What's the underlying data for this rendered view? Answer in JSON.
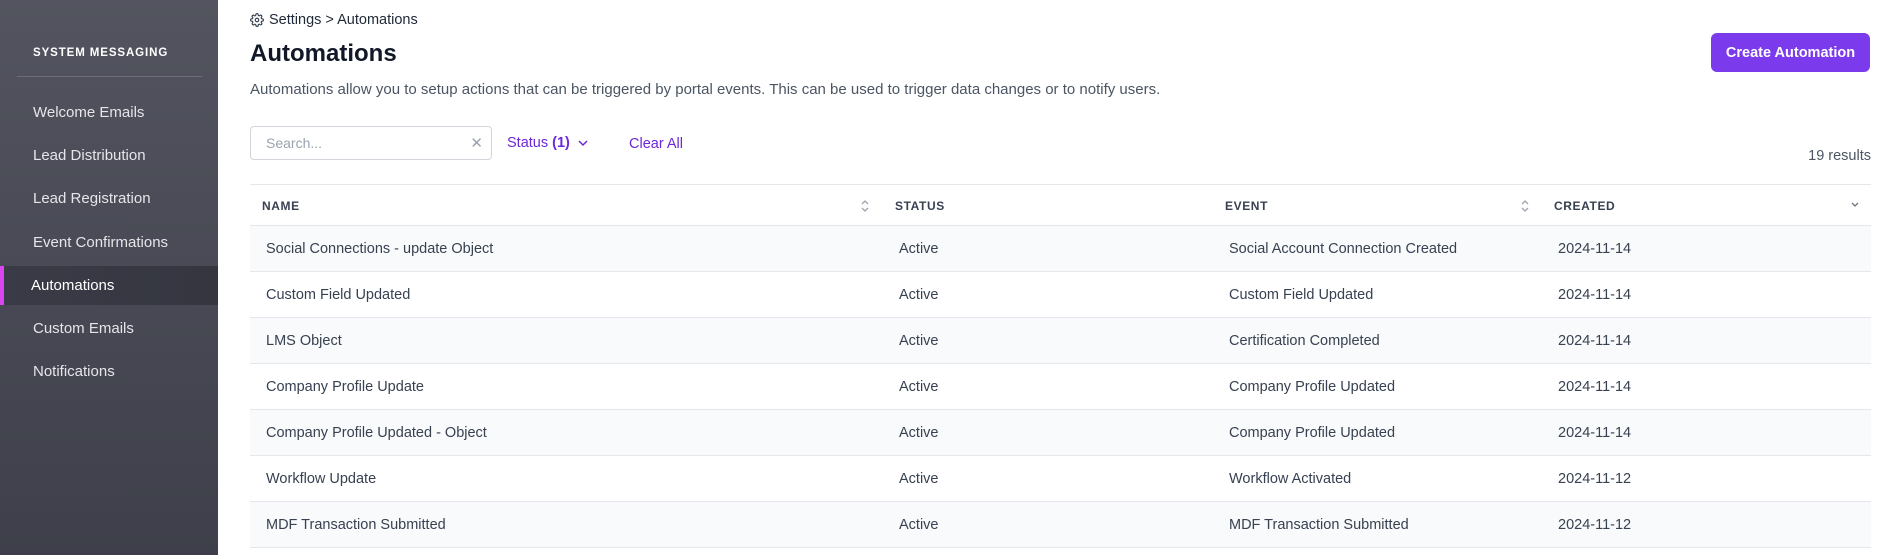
{
  "sidebar": {
    "heading": "SYSTEM MESSAGING",
    "items": [
      {
        "label": "Welcome Emails",
        "active": false
      },
      {
        "label": "Lead Distribution",
        "active": false
      },
      {
        "label": "Lead Registration",
        "active": false
      },
      {
        "label": "Event Confirmations",
        "active": false
      },
      {
        "label": "Automations",
        "active": true
      },
      {
        "label": "Custom Emails",
        "active": false
      },
      {
        "label": "Notifications",
        "active": false
      }
    ]
  },
  "breadcrumb": {
    "icon": "gear-icon",
    "text": "Settings > Automations"
  },
  "header": {
    "title": "Automations",
    "description": "Automations allow you to setup actions that can be triggered by portal events. This can be used to trigger data changes or to notify users.",
    "create_label": "Create Automation"
  },
  "filters": {
    "search_placeholder": "Search...",
    "status_label": "Status",
    "status_count": "(1)",
    "clear_all_label": "Clear All",
    "results_text": "19 results"
  },
  "table": {
    "columns": [
      "NAME",
      "STATUS",
      "EVENT",
      "CREATED"
    ],
    "rows": [
      {
        "name": "Social Connections - update Object",
        "status": "Active",
        "event": "Social Account Connection Created",
        "created": "2024-11-14"
      },
      {
        "name": "Custom Field Updated",
        "status": "Active",
        "event": "Custom Field Updated",
        "created": "2024-11-14"
      },
      {
        "name": "LMS Object",
        "status": "Active",
        "event": "Certification Completed",
        "created": "2024-11-14"
      },
      {
        "name": "Company Profile Update",
        "status": "Active",
        "event": "Company Profile Updated",
        "created": "2024-11-14"
      },
      {
        "name": "Company Profile Updated - Object",
        "status": "Active",
        "event": "Company Profile Updated",
        "created": "2024-11-14"
      },
      {
        "name": "Workflow Update",
        "status": "Active",
        "event": "Workflow Activated",
        "created": "2024-11-12"
      },
      {
        "name": "MDF Transaction Submitted",
        "status": "Active",
        "event": "MDF Transaction Submitted",
        "created": "2024-11-12"
      }
    ]
  },
  "colors": {
    "accent": "#7c3aed",
    "sidebar_active_marker": "#d946ef",
    "sidebar_bg": "#4a4b56"
  }
}
